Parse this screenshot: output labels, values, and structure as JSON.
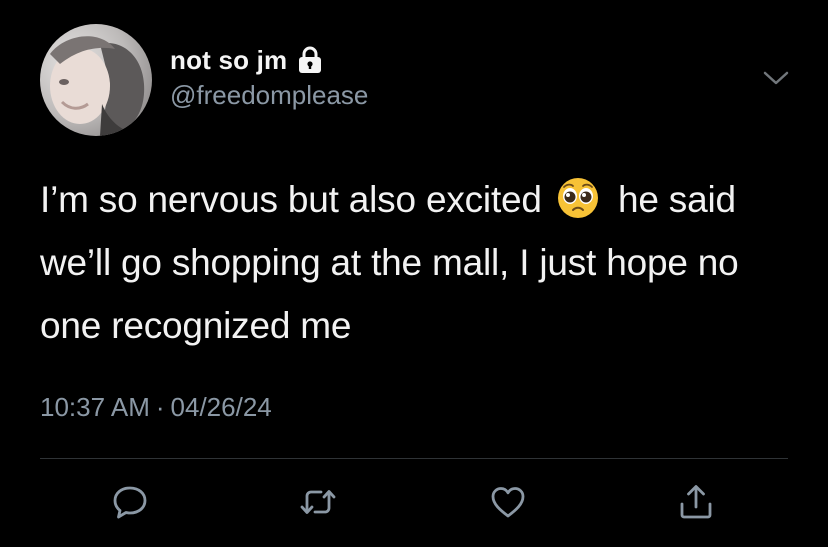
{
  "user": {
    "display_name": "not so jm",
    "handle": "@freedomplease",
    "protected_icon": "lock-icon"
  },
  "tweet": {
    "text_part1": "I’m so nervous but also excited",
    "emoji": "pleading-face-emoji",
    "text_part2": "he said we’ll go shopping at the mall, I just hope no one recognized me",
    "time": "10:37 AM",
    "separator": "·",
    "date": "04/26/24"
  },
  "actions": [
    "reply-icon",
    "retweet-icon",
    "like-icon",
    "share-icon"
  ],
  "colors": {
    "background": "#000000",
    "text": "#f2f2f2",
    "muted": "#8b98a5",
    "divider": "#2f3336"
  }
}
